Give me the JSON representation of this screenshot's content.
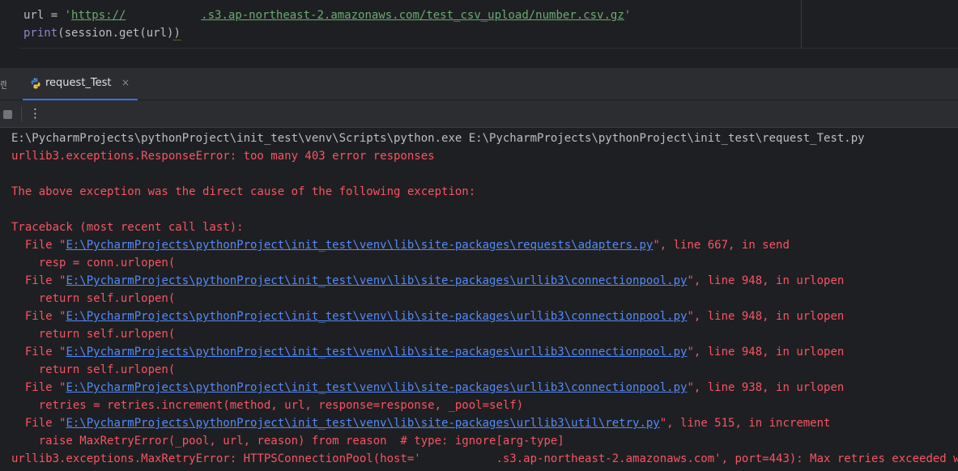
{
  "editor": {
    "line1": {
      "prefix": "url = ",
      "quote_open": "'",
      "url_part1": "https://",
      "url_gap": "           ",
      "url_part2": ".s3.ap-northeast-2.amazonaws.com/test_csv_upload/number.csv.gz",
      "quote_close": "'"
    },
    "line2": {
      "func": "print",
      "rest": "(session.get(url)",
      "close_paren": ")"
    }
  },
  "tabbar": {
    "stub_label": "랜",
    "tab_label": "request_Test",
    "close_glyph": "×"
  },
  "toolbar": {
    "more_glyph": "⋮"
  },
  "console": {
    "command": "E:\\PycharmProjects\\pythonProject\\init_test\\venv\\Scripts\\python.exe E:\\PycharmProjects\\pythonProject\\init_test\\request_Test.py",
    "error1": "urllib3.exceptions.ResponseError: too many 403 error responses",
    "cause": "The above exception was the direct cause of the following exception:",
    "traceback_header": "Traceback (most recent call last):",
    "frames": [
      {
        "prefix": "  File \"",
        "path": "E:\\PycharmProjects\\pythonProject\\init_test\\venv\\lib\\site-packages\\requests\\adapters.py",
        "suffix": "\", line 667, in send",
        "code": "    resp = conn.urlopen("
      },
      {
        "prefix": "  File \"",
        "path": "E:\\PycharmProjects\\pythonProject\\init_test\\venv\\lib\\site-packages\\urllib3\\connectionpool.py",
        "suffix": "\", line 948, in urlopen",
        "code": "    return self.urlopen("
      },
      {
        "prefix": "  File \"",
        "path": "E:\\PycharmProjects\\pythonProject\\init_test\\venv\\lib\\site-packages\\urllib3\\connectionpool.py",
        "suffix": "\", line 948, in urlopen",
        "code": "    return self.urlopen("
      },
      {
        "prefix": "  File \"",
        "path": "E:\\PycharmProjects\\pythonProject\\init_test\\venv\\lib\\site-packages\\urllib3\\connectionpool.py",
        "suffix": "\", line 948, in urlopen",
        "code": "    return self.urlopen("
      },
      {
        "prefix": "  File \"",
        "path": "E:\\PycharmProjects\\pythonProject\\init_test\\venv\\lib\\site-packages\\urllib3\\connectionpool.py",
        "suffix": "\", line 938, in urlopen",
        "code": "    retries = retries.increment(method, url, response=response, _pool=self)"
      },
      {
        "prefix": "  File \"",
        "path": "E:\\PycharmProjects\\pythonProject\\init_test\\venv\\lib\\site-packages\\urllib3\\util\\retry.py",
        "suffix": "\", line 515, in increment",
        "code": "    raise MaxRetryError(_pool, url, reason) from reason  # type: ignore[arg-type]"
      }
    ],
    "final_error": "urllib3.exceptions.MaxRetryError: HTTPSConnectionPool(host='           .s3.ap-northeast-2.amazonaws.com', port=443): Max retries exceeded with url:"
  },
  "colors": {
    "background": "#1e1f22",
    "panel": "#2b2d30",
    "error_text": "#f75464",
    "link": "#548af7",
    "string": "#6aab73",
    "tab_accent": "#3574f0"
  }
}
